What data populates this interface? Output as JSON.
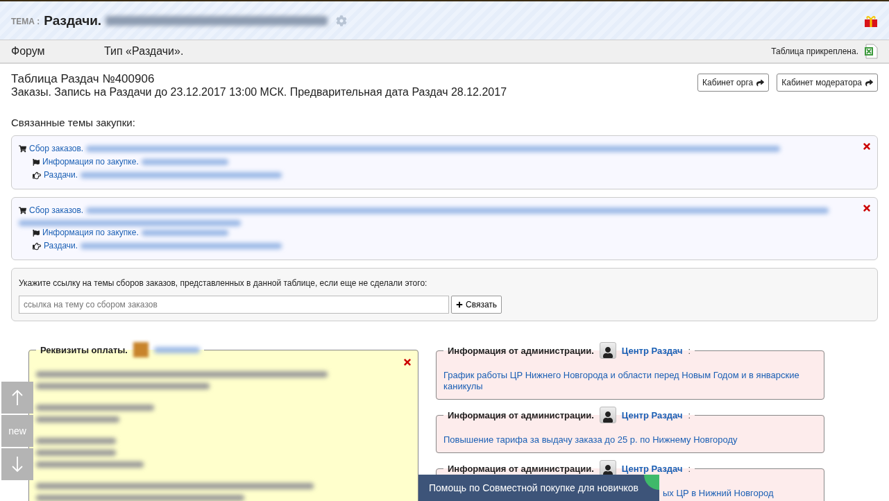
{
  "topic": {
    "prefix": "ТЕМА :",
    "title": "Раздачи."
  },
  "nav": {
    "items": [
      "Форум",
      "Тип «Раздачи»."
    ],
    "attachment": "Таблица прикреплена."
  },
  "table": {
    "title": "Таблица Раздач №400906",
    "subtitle": "Заказы. Запись на Раздачи до 23.12.2017 13:00 МСК. Предварительная дата Раздач 28.12.2017",
    "buttons": [
      "Кабинет орга",
      "Кабинет модератора"
    ]
  },
  "related": {
    "heading": "Связанные темы закупки:",
    "topics": [
      {
        "links": [
          {
            "kind": "cart",
            "label": "Сбор заказов."
          },
          {
            "kind": "flag",
            "label": "Информация по закупке."
          },
          {
            "kind": "hand",
            "label": "Раздачи."
          }
        ]
      },
      {
        "links": [
          {
            "kind": "cart",
            "label": "Сбор заказов."
          },
          {
            "kind": "flag",
            "label": "Информация по закупке."
          },
          {
            "kind": "hand",
            "label": "Раздачи."
          }
        ]
      }
    ]
  },
  "link_form": {
    "prompt": "Укажите ссылку на темы сборов заказов, представленных в данной таблице, если еще не сделали этого:",
    "placeholder": "ссылка на тему со сбором заказов",
    "button": "Связать"
  },
  "payment": {
    "title": "Реквизиты оплаты."
  },
  "side_nav": {
    "label": "new"
  },
  "admin_notices": [
    {
      "title": "Информация от администрации.",
      "author": "Центр Раздач",
      "suffix": ":",
      "text": "График работы ЦР Нижнего Новгорода и области перед Новым Годом и в январские каникулы"
    },
    {
      "title": "Информация от администрации.",
      "author": "Центр Раздач",
      "suffix": ":",
      "text": "Повышение тарифа за выдачу заказа до 25 р. по Нижнему Новгороду"
    },
    {
      "title": "Информация от администрации.",
      "author": "Центр Раздач",
      "suffix": ":",
      "text": "ых ЦР в Нижний Новгород"
    }
  ],
  "help_bar": {
    "label": "Помощь по Совместной покупке для новичков"
  }
}
